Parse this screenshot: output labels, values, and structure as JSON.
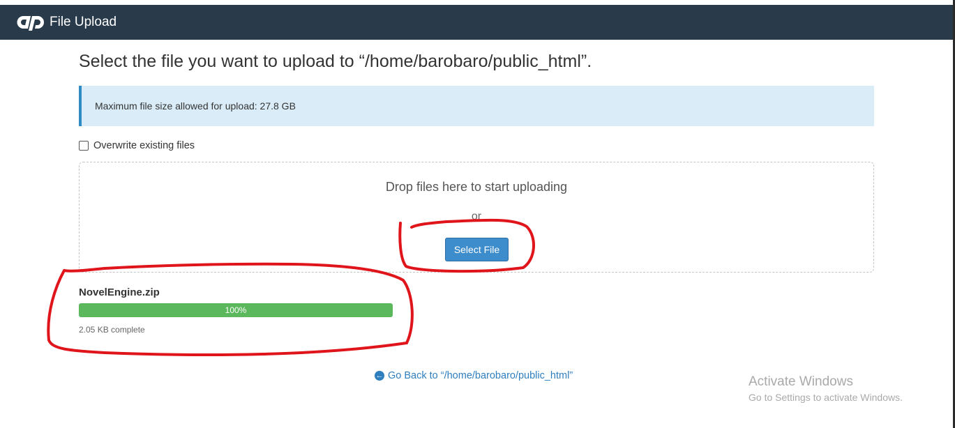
{
  "header": {
    "logo_icon": "cpanel-logo",
    "title": "File Upload",
    "background": "#293a4a"
  },
  "main": {
    "title": "Select the file you want to upload to “/home/barobaro/public_html”.",
    "info": "Maximum file size allowed for upload: 27.8 GB",
    "overwrite_label": "Overwrite existing files",
    "overwrite_checked": false,
    "dropzone": {
      "text": "Drop files here to start uploading",
      "or": "or",
      "select_button": "Select File"
    },
    "upload": {
      "file_name": "NovelEngine.zip",
      "progress_label": "100%",
      "progress_percent": 100,
      "status": "2.05 KB complete"
    },
    "go_back": {
      "icon": "arrow-circle-left-icon",
      "label": "Go Back to “/home/barobaro/public_html”"
    }
  },
  "watermark": {
    "title": "Activate Windows",
    "subtitle": "Go to Settings to activate Windows."
  },
  "colors": {
    "accent": "#3d8ccc",
    "progress": "#5cb85c",
    "info_bg": "#d9ecf7",
    "annotation": "#e0141b"
  }
}
